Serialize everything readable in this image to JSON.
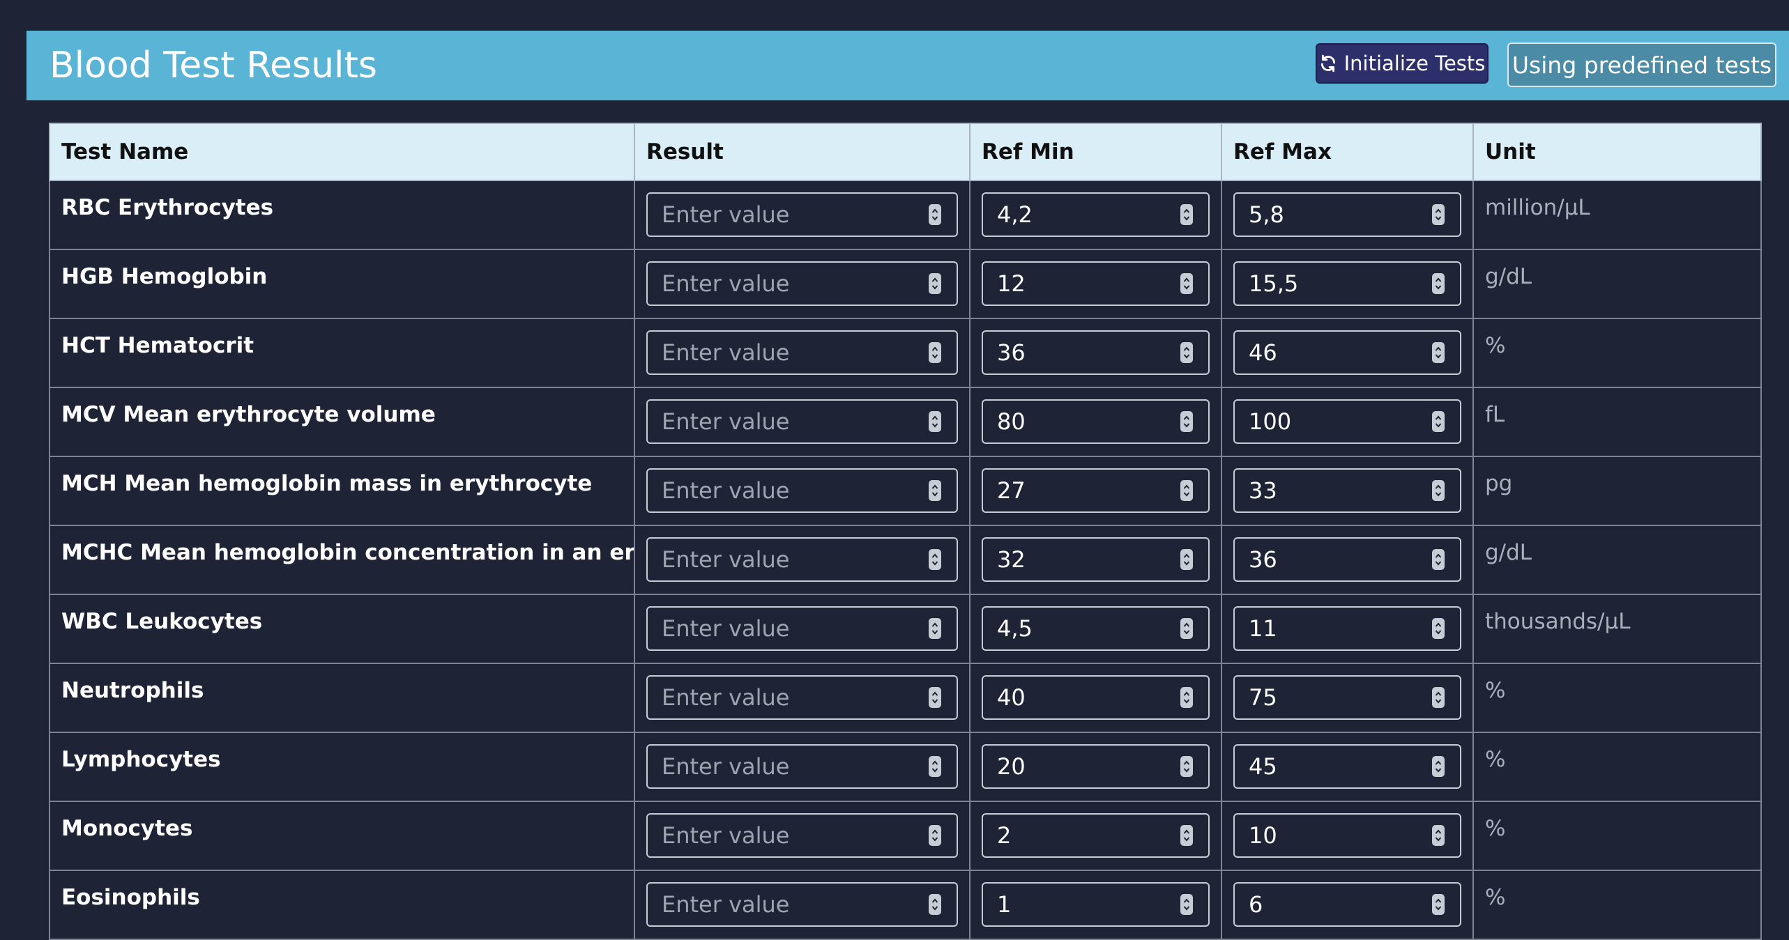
{
  "header": {
    "title": "Blood Test Results",
    "init_button_label": "Initialize Tests",
    "predefined_button_label": "Using predefined tests"
  },
  "table": {
    "columns": [
      "Test Name",
      "Result",
      "Ref Min",
      "Ref Max",
      "Unit"
    ],
    "result_placeholder": "Enter value",
    "rows": [
      {
        "name": "RBC Erythrocytes",
        "ref_min": "4,2",
        "ref_max": "5,8",
        "unit": "million/µL"
      },
      {
        "name": "HGB Hemoglobin",
        "ref_min": "12",
        "ref_max": "15,5",
        "unit": "g/dL"
      },
      {
        "name": "HCT Hematocrit",
        "ref_min": "36",
        "ref_max": "46",
        "unit": "%"
      },
      {
        "name": "MCV Mean erythrocyte volume",
        "ref_min": "80",
        "ref_max": "100",
        "unit": "fL"
      },
      {
        "name": "MCH Mean hemoglobin mass in erythrocyte",
        "ref_min": "27",
        "ref_max": "33",
        "unit": "pg"
      },
      {
        "name": "MCHC Mean hemoglobin concentration in an erythrocyte",
        "ref_min": "32",
        "ref_max": "36",
        "unit": "g/dL"
      },
      {
        "name": "WBC Leukocytes",
        "ref_min": "4,5",
        "ref_max": "11",
        "unit": "thousands/µL"
      },
      {
        "name": "Neutrophils",
        "ref_min": "40",
        "ref_max": "75",
        "unit": "%"
      },
      {
        "name": "Lymphocytes",
        "ref_min": "20",
        "ref_max": "45",
        "unit": "%"
      },
      {
        "name": "Monocytes",
        "ref_min": "2",
        "ref_max": "10",
        "unit": "%"
      },
      {
        "name": "Eosinophils",
        "ref_min": "1",
        "ref_max": "6",
        "unit": "%"
      }
    ]
  },
  "colors": {
    "background": "#1e2436",
    "header_bar": "#5ab4d6",
    "init_button": "#2d2f6b",
    "table_header": "#d9eef6"
  }
}
